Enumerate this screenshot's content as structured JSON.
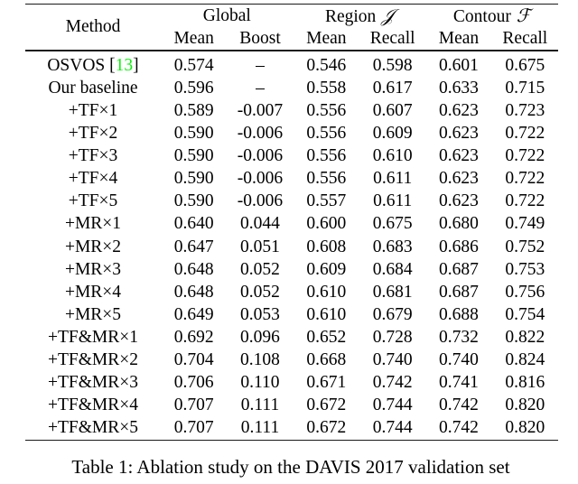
{
  "table": {
    "header": {
      "method_label": "Method",
      "groups": [
        {
          "name": "group-global",
          "label": "Global",
          "symbol": ""
        },
        {
          "name": "group-region",
          "label": "Region",
          "symbol": "𝒥"
        },
        {
          "name": "group-contour",
          "label": "Contour",
          "symbol": "ℱ"
        }
      ],
      "subheaders": [
        "Mean",
        "Boost",
        "Mean",
        "Recall",
        "Mean",
        "Recall"
      ]
    },
    "rows": [
      {
        "method": "OSVOS",
        "citation": "13",
        "citation_color": "#0bf10b",
        "values": [
          "0.574",
          "–",
          "0.546",
          "0.598",
          "0.601",
          "0.675"
        ]
      },
      {
        "method": "Our baseline",
        "citation": null,
        "values": [
          "0.596",
          "–",
          "0.558",
          "0.617",
          "0.633",
          "0.715"
        ]
      },
      {
        "method": "+TF×1",
        "citation": null,
        "values": [
          "0.589",
          "-0.007",
          "0.556",
          "0.607",
          "0.623",
          "0.723"
        ]
      },
      {
        "method": "+TF×2",
        "citation": null,
        "values": [
          "0.590",
          "-0.006",
          "0.556",
          "0.609",
          "0.623",
          "0.722"
        ]
      },
      {
        "method": "+TF×3",
        "citation": null,
        "values": [
          "0.590",
          "-0.006",
          "0.556",
          "0.610",
          "0.623",
          "0.722"
        ]
      },
      {
        "method": "+TF×4",
        "citation": null,
        "values": [
          "0.590",
          "-0.006",
          "0.556",
          "0.611",
          "0.623",
          "0.722"
        ]
      },
      {
        "method": "+TF×5",
        "citation": null,
        "values": [
          "0.590",
          "-0.006",
          "0.557",
          "0.611",
          "0.623",
          "0.722"
        ]
      },
      {
        "method": "+MR×1",
        "citation": null,
        "values": [
          "0.640",
          "0.044",
          "0.600",
          "0.675",
          "0.680",
          "0.749"
        ]
      },
      {
        "method": "+MR×2",
        "citation": null,
        "values": [
          "0.647",
          "0.051",
          "0.608",
          "0.683",
          "0.686",
          "0.752"
        ]
      },
      {
        "method": "+MR×3",
        "citation": null,
        "values": [
          "0.648",
          "0.052",
          "0.609",
          "0.684",
          "0.687",
          "0.753"
        ]
      },
      {
        "method": "+MR×4",
        "citation": null,
        "values": [
          "0.648",
          "0.052",
          "0.610",
          "0.681",
          "0.687",
          "0.756"
        ]
      },
      {
        "method": "+MR×5",
        "citation": null,
        "values": [
          "0.649",
          "0.053",
          "0.610",
          "0.679",
          "0.688",
          "0.754"
        ]
      },
      {
        "method": "+TF&MR×1",
        "citation": null,
        "values": [
          "0.692",
          "0.096",
          "0.652",
          "0.728",
          "0.732",
          "0.822"
        ]
      },
      {
        "method": "+TF&MR×2",
        "citation": null,
        "values": [
          "0.704",
          "0.108",
          "0.668",
          "0.740",
          "0.740",
          "0.824"
        ]
      },
      {
        "method": "+TF&MR×3",
        "citation": null,
        "values": [
          "0.706",
          "0.110",
          "0.671",
          "0.742",
          "0.741",
          "0.816"
        ]
      },
      {
        "method": "+TF&MR×4",
        "citation": null,
        "values": [
          "0.707",
          "0.111",
          "0.672",
          "0.744",
          "0.742",
          "0.820"
        ]
      },
      {
        "method": "+TF&MR×5",
        "citation": null,
        "values": [
          "0.707",
          "0.111",
          "0.672",
          "0.744",
          "0.742",
          "0.820"
        ]
      }
    ]
  },
  "caption": {
    "text": "Table 1: Ablation study on the DAVIS 2017 validation set"
  }
}
